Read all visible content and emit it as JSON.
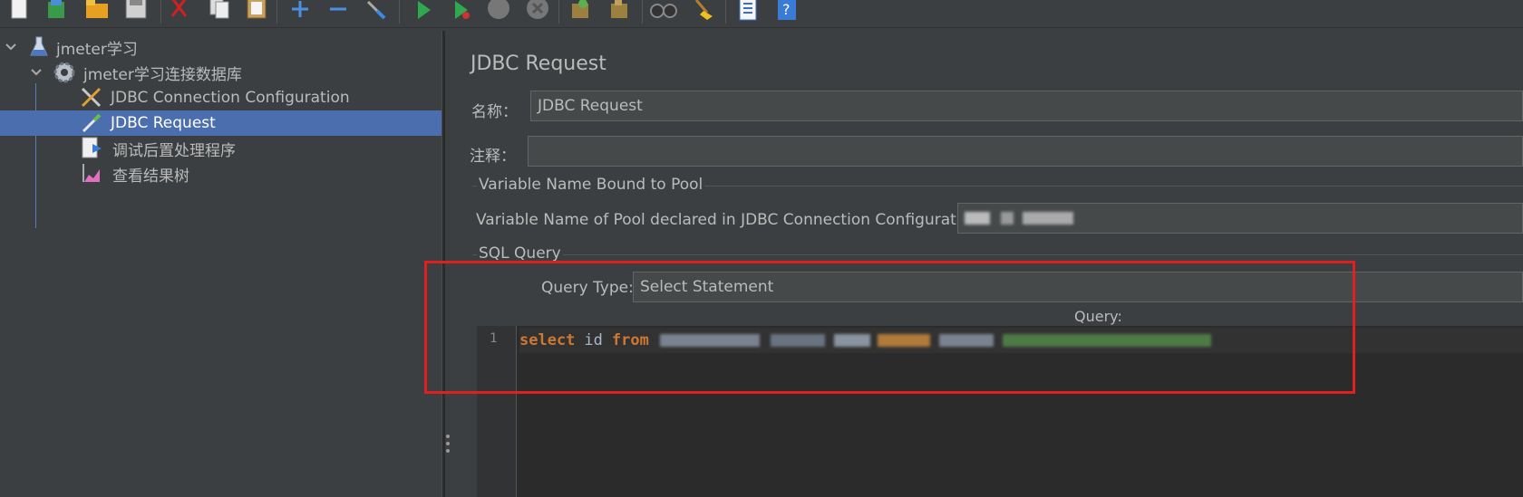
{
  "toolbar": {
    "icons": [
      "new-icon",
      "templates-icon",
      "open-icon",
      "save-icon",
      "cut-icon",
      "copy-icon",
      "paste-icon",
      "expand-icon",
      "collapse-icon",
      "toggle-icon",
      "start-icon",
      "start-no-pause-icon",
      "stop-icon",
      "shutdown-icon",
      "clear-icon",
      "clear-all-icon",
      "search-icon",
      "reset-search-icon",
      "function-helper-icon",
      "help-icon"
    ]
  },
  "tree": {
    "items": [
      {
        "label": "jmeter学习",
        "icon": "test-plan-flask-icon",
        "level": 0,
        "expanded": true
      },
      {
        "label": "jmeter学习连接数据库",
        "icon": "thread-group-gear-icon",
        "level": 1,
        "expanded": true
      },
      {
        "label": "JDBC Connection Configuration",
        "icon": "config-tools-icon",
        "level": 2
      },
      {
        "label": "JDBC Request",
        "icon": "sampler-pipette-icon",
        "level": 2,
        "selected": true
      },
      {
        "label": "调试后置处理程序",
        "icon": "debug-postprocessor-icon",
        "level": 2
      },
      {
        "label": "查看结果树",
        "icon": "result-tree-icon",
        "level": 2
      }
    ]
  },
  "panel": {
    "title": "JDBC Request",
    "name_label": "名称：",
    "name_value": "JDBC Request",
    "comment_label": "注释：",
    "comment_value": "",
    "pool_group_title": "Variable Name Bound to Pool",
    "pool_label": "Variable Name of Pool declared in JDBC Connection Configuration:",
    "sql_group_title": "SQL Query",
    "query_type_label": "Query Type:",
    "query_type_value": "Select Statement",
    "query_label": "Query:",
    "code": {
      "line_number": "1",
      "kw_select": "select",
      "col": "id",
      "kw_from": "from"
    }
  },
  "colors": {
    "background": "#3c3f41",
    "selection": "#4b6eaf",
    "keyword": "#cc7832",
    "string": "#6a8759",
    "highlight_box": "#e0201f"
  }
}
